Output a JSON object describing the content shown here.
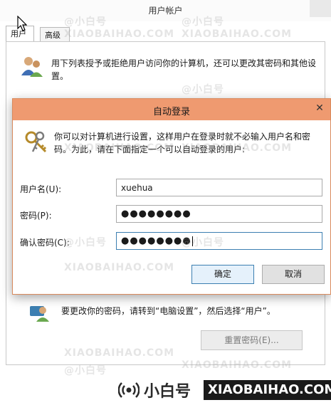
{
  "background_window": {
    "title": "用户帐户",
    "tabs": [
      {
        "label": "用户"
      },
      {
        "label": "高级"
      }
    ],
    "description": "用下列表授予或拒绝用户访问你的计算机，还可以更改其密码和其他设置。",
    "password_text": "要更改你的密码，请转到“电脑设置”，然后选择“用户”。",
    "reset_password_button": "重置密码(E)..."
  },
  "dialog": {
    "title": "自动登录",
    "close_glyph": "✕",
    "description": "你可以对计算机进行设置，这样用户在登录时就不必输入用户名和密码。为此，请在下面指定一个可以自动登录的用户:",
    "fields": {
      "username": {
        "label": "用户名(U):",
        "value": "xuehua"
      },
      "password": {
        "label": "密码(P):",
        "value": "●●●●●●●●"
      },
      "confirm": {
        "label": "确认密码(C):",
        "value": "●●●●●●●●"
      }
    },
    "ok_button": "确定",
    "cancel_button": "取消"
  },
  "watermark": {
    "cn": "@小白号",
    "en": "XIAOBAIHAO.COM"
  },
  "brand": {
    "cn": "小白号",
    "en": "XIAOBAIHAO.COM"
  }
}
